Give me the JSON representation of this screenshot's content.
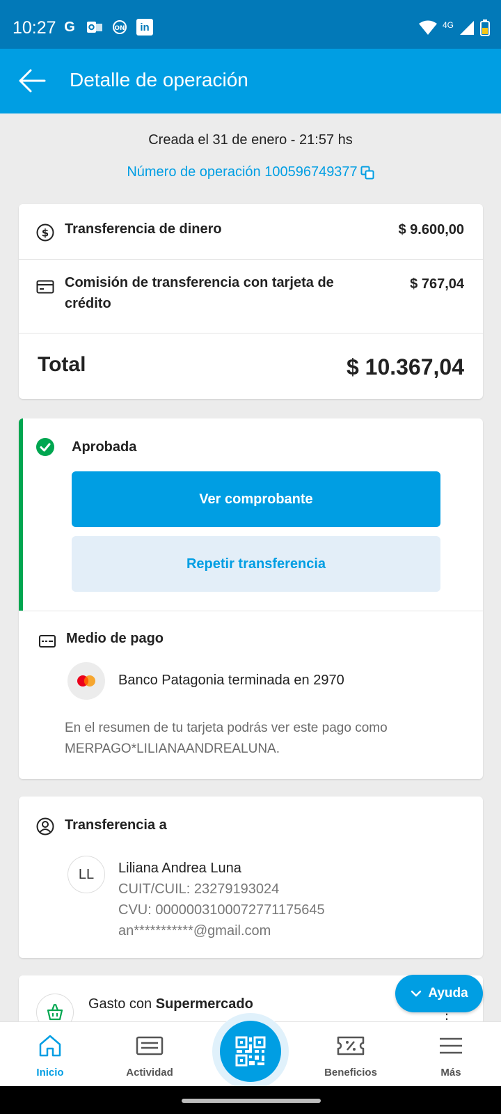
{
  "status_bar": {
    "time": "10:27",
    "app_icons": [
      "google-icon",
      "outlook-icon",
      "on-icon",
      "linkedin-icon"
    ],
    "network": "4G"
  },
  "header": {
    "title": "Detalle de operación",
    "back_icon": "arrow-left-icon"
  },
  "operation": {
    "created": "Creada el 31 de enero - 21:57 hs",
    "number": "Número de operación 100596749377"
  },
  "summary": {
    "items": [
      {
        "label": "Transferencia de dinero",
        "amount": "$ 9.600,00",
        "icon": "dollar-circle-icon"
      },
      {
        "label": "Comisión de transferencia con tarjeta de crédito",
        "amount": "$ 767,04",
        "icon": "credit-card-icon"
      }
    ],
    "total_label": "Total",
    "total_amount": "$ 10.367,04"
  },
  "status_card": {
    "status": "Aprobada",
    "primary_button": "Ver comprobante",
    "secondary_button": "Repetir transferencia",
    "payment_method": {
      "title": "Medio de pago",
      "bank": "Banco Patagonia terminada en 2970",
      "note": "En el resumen de tu tarjeta podrás ver este pago como MERPAGO*LILIANAANDREALUNA."
    }
  },
  "recipient": {
    "title": "Transferencia a",
    "initials": "LL",
    "name": "Liliana Andrea Luna",
    "cuit": "CUIT/CUIL: 23279193024",
    "cvu": "CVU: 0000003100072771175645",
    "email": "an***********@gmail.com"
  },
  "expense": {
    "prefix": "Gasto con",
    "category": "Supermercado"
  },
  "help_button": "Ayuda",
  "tabs": [
    {
      "label": "Inicio",
      "icon": "home-icon",
      "active": true
    },
    {
      "label": "Actividad",
      "icon": "activity-icon",
      "active": false
    },
    {
      "label": "Beneficios",
      "icon": "coupon-icon",
      "active": false
    },
    {
      "label": "Más",
      "icon": "menu-icon",
      "active": false
    }
  ],
  "colors": {
    "primary": "#009ee3",
    "status_bar": "#0279b8",
    "approved": "#00a650"
  }
}
